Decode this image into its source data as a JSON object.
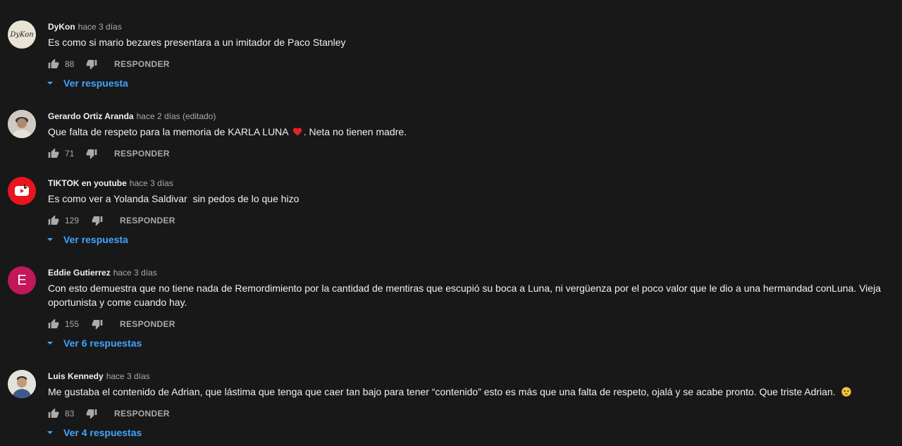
{
  "colors": {
    "background": "#181818",
    "link_blue": "#3ea6ff",
    "secondary_text": "#aaaaaa",
    "primary_text": "#f1f1f1"
  },
  "comments": [
    {
      "author": "DyKon",
      "time": "hace 3 días",
      "text": "Es como si mario bezares presentara a un imitador de Paco Stanley",
      "likes": "88",
      "reply_label": "RESPONDER",
      "replies_label": "Ver respuesta",
      "avatar_text": "DyKon"
    },
    {
      "author": "Gerardo Ortiz Aranda",
      "time": "hace 2 días (editado)",
      "text_before": "Que falta de respeto para la memoria de KARLA LUNA",
      "text_after": ". Neta no tienen madre.",
      "likes": "71",
      "reply_label": "RESPONDER"
    },
    {
      "author": "TIKTOK en youtube",
      "time": "hace 3 días",
      "text": "Es como ver a Yolanda Saldivar  sin pedos de lo que hizo",
      "likes": "129",
      "reply_label": "RESPONDER",
      "replies_label": "Ver respuesta"
    },
    {
      "author": "Eddie Gutierrez",
      "time": "hace 3 días",
      "text": "Con esto demuestra que no tiene nada de Remordimiento por la cantidad de mentiras que escupió su boca a Luna, ni vergüenza por el poco valor que le dio a una hermandad conLuna. Vieja oportunista y come cuando hay.",
      "likes": "155",
      "reply_label": "RESPONDER",
      "replies_label": "Ver 6 respuestas",
      "avatar_letter": "E",
      "avatar_color": "#c2185b"
    },
    {
      "author": "Luis Kennedy",
      "time": "hace 3 días",
      "text": "Me gustaba el contenido de Adrian, que lástima que tenga que caer tan bajo para tener “contenido” esto es más que una falta de respeto, ojalá y se acabe pronto. Que triste Adrian.",
      "likes": "83",
      "reply_label": "RESPONDER",
      "replies_label": "Ver 4 respuestas"
    }
  ]
}
